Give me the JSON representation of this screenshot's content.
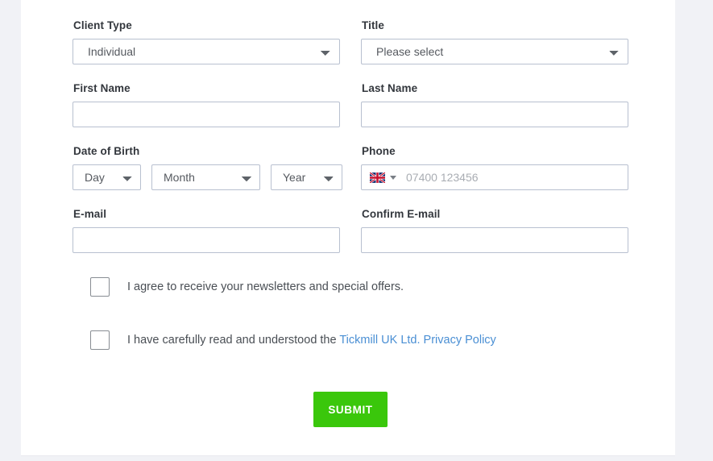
{
  "form": {
    "rows": [
      {
        "left": {
          "label": "Client Type",
          "type": "select",
          "value": "Individual",
          "name": "client-type"
        },
        "right": {
          "label": "Title",
          "type": "select",
          "value": "Please select",
          "name": "title"
        }
      },
      {
        "left": {
          "label": "First Name",
          "type": "text",
          "value": "",
          "placeholder": "",
          "name": "first-name"
        },
        "right": {
          "label": "Last Name",
          "type": "text",
          "value": "",
          "placeholder": "",
          "name": "last-name"
        }
      },
      {
        "left": {
          "label": "Date of Birth",
          "type": "dob",
          "name": "date-of-birth"
        },
        "right": {
          "label": "Phone",
          "type": "phone",
          "name": "phone"
        }
      },
      {
        "left": {
          "label": "E-mail",
          "type": "text",
          "value": "",
          "placeholder": "",
          "name": "email"
        },
        "right": {
          "label": "Confirm E-mail",
          "type": "text",
          "value": "",
          "placeholder": "",
          "name": "confirm-email"
        }
      }
    ],
    "dob": {
      "day_value": "Day",
      "month_value": "Month",
      "year_value": "Year"
    },
    "phone": {
      "country_flag": "uk-flag-icon",
      "country_code": "GB",
      "placeholder": "07400 123456",
      "value": ""
    },
    "consents": [
      {
        "text": "I agree to receive your newsletters and special offers.",
        "link_text": "",
        "checked": false,
        "name": "newsletter-consent"
      },
      {
        "text": "I have carefully read and understood the ",
        "link_text": "Tickmill UK Ltd. Privacy Policy",
        "checked": false,
        "name": "privacy-policy-consent"
      }
    ],
    "submit_label": "SUBMIT"
  },
  "colors": {
    "page_background": "#f1f2f6",
    "card_background": "#ffffff",
    "label_text": "#33373d",
    "field_border": "#b8c0d0",
    "placeholder_text": "#a9adb3",
    "link_blue": "#4a8fd4",
    "submit_green": "#3ac70b",
    "checkbox_border": "#888d93"
  }
}
